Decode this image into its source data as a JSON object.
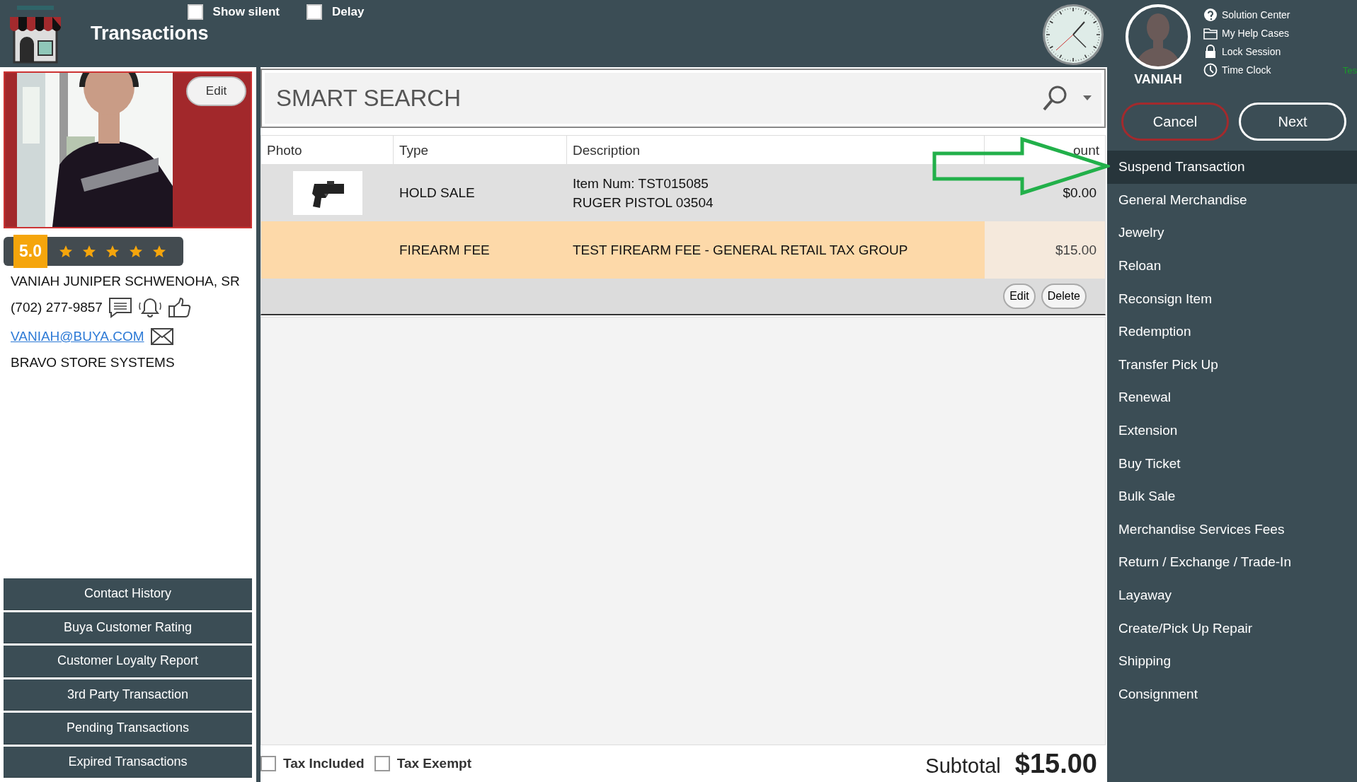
{
  "header": {
    "title": "Transactions",
    "toggles": [
      {
        "label": "Show silent",
        "checked": false
      },
      {
        "label": "Delay",
        "checked": false
      }
    ]
  },
  "user": {
    "name": "VANIAH"
  },
  "help_links": [
    "Solution Center",
    "My Help Cases",
    "Lock Session",
    "Time Clock"
  ],
  "corner_text": "Tes",
  "buttons": [
    {
      "label": "Cancel",
      "kind": "cancel"
    },
    {
      "label": "Next",
      "kind": "next"
    }
  ],
  "menu": [
    {
      "label": "Suspend Transaction",
      "selected": true
    },
    {
      "label": "General Merchandise",
      "selected": false
    },
    {
      "label": "Jewelry",
      "selected": false
    },
    {
      "label": "Reloan",
      "selected": false
    },
    {
      "label": "Reconsign Item",
      "selected": false
    },
    {
      "label": "Redemption",
      "selected": false
    },
    {
      "label": "Transfer Pick Up",
      "selected": false
    },
    {
      "label": "Renewal",
      "selected": false
    },
    {
      "label": "Extension",
      "selected": false
    },
    {
      "label": "Buy Ticket",
      "selected": false
    },
    {
      "label": "Bulk Sale",
      "selected": false
    },
    {
      "label": "Merchandise Services Fees",
      "selected": false
    },
    {
      "label": "Return / Exchange / Trade-In",
      "selected": false
    },
    {
      "label": "Layaway",
      "selected": false
    },
    {
      "label": "Create/Pick Up Repair",
      "selected": false
    },
    {
      "label": "Shipping",
      "selected": false
    },
    {
      "label": "Consignment",
      "selected": false
    }
  ],
  "customer": {
    "edit_label": "Edit",
    "rating": "5.0",
    "stars": 5,
    "name": "VANIAH JUNIPER SCHWENOHA, SR",
    "phone": "(702) 277-9857",
    "email": "VANIAH@BUYA.COM",
    "company": "BRAVO STORE SYSTEMS"
  },
  "customer_actions": [
    "Contact History",
    "Buya Customer Rating",
    "Customer Loyalty Report",
    "3rd Party Transaction",
    "Pending Transactions",
    "Expired Transactions"
  ],
  "search": {
    "placeholder": "SMART SEARCH"
  },
  "table": {
    "columns": [
      "Photo",
      "Type",
      "Description",
      "ount"
    ],
    "rows": [
      {
        "type": "HOLD SALE",
        "description": [
          "Item Num: TST015085",
          "RUGER PISTOL 03504"
        ],
        "amount": "$0.00",
        "selected": false
      },
      {
        "type": "FIREARM FEE",
        "description": [
          "TEST FIREARM FEE - GENERAL RETAIL TAX GROUP"
        ],
        "amount": "$15.00",
        "selected": true
      }
    ],
    "row_actions": [
      "Edit",
      "Delete"
    ]
  },
  "tax_options": [
    {
      "label": "Tax Included",
      "checked": false
    },
    {
      "label": "Tax Exempt",
      "checked": false
    }
  ],
  "subtotal": {
    "label": "Subtotal",
    "value": "$15.00"
  }
}
